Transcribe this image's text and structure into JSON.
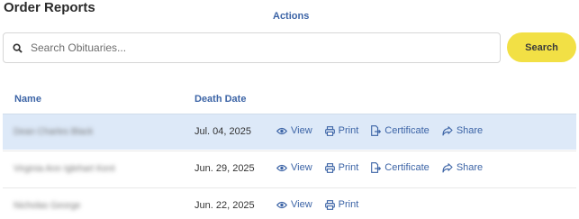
{
  "page": {
    "title": "Order Reports"
  },
  "search": {
    "placeholder": "Search Obituaries...",
    "value": "",
    "button_label": "Search"
  },
  "table": {
    "headers": {
      "name": "Name",
      "death_date": "Death Date",
      "actions": "Actions"
    },
    "rows": [
      {
        "name": "Dean Charles Black",
        "death_date": "Jul. 04, 2025",
        "actions": [
          "View",
          "Print",
          "Certificate",
          "Share"
        ]
      },
      {
        "name": "Virginia Ann Iglehart Kent",
        "death_date": "Jun. 29, 2025",
        "actions": [
          "View",
          "Print",
          "Certificate",
          "Share"
        ]
      },
      {
        "name": "Nicholas George",
        "death_date": "Jun. 22, 2025",
        "actions": [
          "View",
          "Print"
        ]
      }
    ]
  },
  "colors": {
    "accent": "#3c64a6",
    "button": "#f2e045",
    "selected_row": "#dde9f8"
  }
}
